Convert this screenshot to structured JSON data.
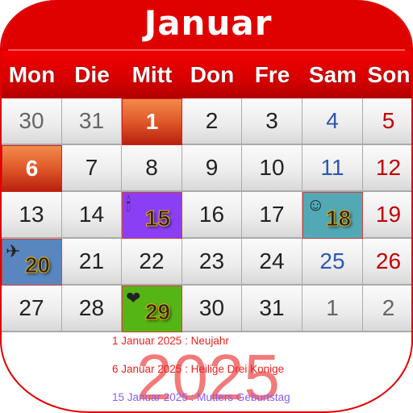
{
  "header": {
    "month": "Januar",
    "year": "2025"
  },
  "weekdays": [
    "Mon",
    "Die",
    "Mitt",
    "Don",
    "Fre",
    "Sam",
    "Son"
  ],
  "colors": {
    "header_red": "#df0000",
    "saturday": "#2f56b0",
    "sunday": "#c40000",
    "holiday": "#e0582a",
    "event_purple": "#8a3ff5",
    "event_teal": "#52a9b5",
    "event_blue": "#5a86bf",
    "event_green": "#55b515",
    "holiday_text": "#ee2020",
    "birthday_text": "#8a5cf0"
  },
  "weeks": [
    [
      {
        "d": "30",
        "t": "other"
      },
      {
        "d": "31",
        "t": "other"
      },
      {
        "d": "1",
        "t": "holiday"
      },
      {
        "d": "2"
      },
      {
        "d": "3"
      },
      {
        "d": "4",
        "t": "sat"
      },
      {
        "d": "5",
        "t": "sun"
      }
    ],
    [
      {
        "d": "6",
        "t": "holiday"
      },
      {
        "d": "7"
      },
      {
        "d": "8"
      },
      {
        "d": "9"
      },
      {
        "d": "10"
      },
      {
        "d": "11",
        "t": "sat"
      },
      {
        "d": "12",
        "t": "sun"
      }
    ],
    [
      {
        "d": "13"
      },
      {
        "d": "14"
      },
      {
        "d": "15",
        "t": "event",
        "icon": "birthday-candles-icon",
        "glyph": "🕯",
        "bg": "#8a3ff5"
      },
      {
        "d": "16"
      },
      {
        "d": "17"
      },
      {
        "d": "18",
        "t": "event",
        "icon": "smiley-icon",
        "glyph": "☺",
        "bg": "#52a9b5"
      },
      {
        "d": "19",
        "t": "sun"
      }
    ],
    [
      {
        "d": "20",
        "t": "event",
        "icon": "airplane-icon",
        "glyph": "✈",
        "bg": "#5a86bf"
      },
      {
        "d": "21"
      },
      {
        "d": "22"
      },
      {
        "d": "23"
      },
      {
        "d": "24"
      },
      {
        "d": "25",
        "t": "sat"
      },
      {
        "d": "26",
        "t": "sun"
      }
    ],
    [
      {
        "d": "27"
      },
      {
        "d": "28"
      },
      {
        "d": "29",
        "t": "event",
        "icon": "heart-ring-icon",
        "glyph": "❤",
        "bg": "#55b515"
      },
      {
        "d": "30"
      },
      {
        "d": "31"
      },
      {
        "d": "1",
        "t": "other"
      },
      {
        "d": "2",
        "t": "other"
      }
    ]
  ],
  "events": [
    {
      "text": "1 Januar 2025 : Neujahr",
      "color": "#ee2020"
    },
    {
      "text": "6 Januar 2025 : Heilige Drei Konige",
      "color": "#ee2020"
    },
    {
      "text": "15 Januar 2025 : Mutters Geburtstag",
      "color": "#8a5cf0"
    }
  ]
}
